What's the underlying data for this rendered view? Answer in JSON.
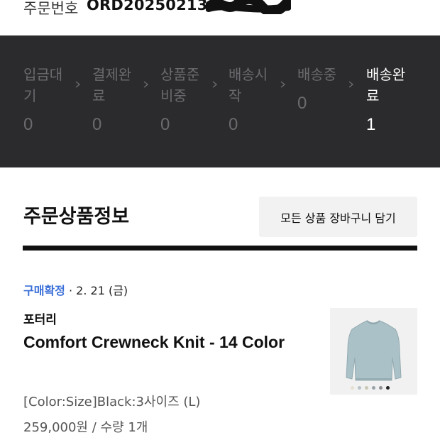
{
  "order": {
    "label": "주문번호",
    "number": "ORD20250213-"
  },
  "steps": [
    {
      "label": "입금대기",
      "count": "0"
    },
    {
      "label": "결제완료",
      "count": "0"
    },
    {
      "label": "상품준비중",
      "count": "0"
    },
    {
      "label": "배송시작",
      "count": "0"
    },
    {
      "label": "배송중",
      "count": "0"
    },
    {
      "label": "배송완료",
      "count": "1"
    }
  ],
  "section": {
    "title": "주문상품정보",
    "cart_all_label": "모든 상품 장바구니 담기"
  },
  "item": {
    "status": "구매확정",
    "date": "· 2. 21 (금)",
    "brand": "포터리",
    "name": "Comfort Crewneck Knit - 14 Color",
    "option": "[Color:Size]Black:3사이즈 (L)",
    "price_qty": "259,000원 / 수량 1개",
    "swatch_colors": [
      "#e6e0d2",
      "#b8c2c8",
      "#c9c8b6",
      "#9aa3a9",
      "#8f8f93",
      "#222222"
    ]
  },
  "colors": {
    "accent": "#3a6fd8",
    "panel": "#2b2b2d",
    "muted": "#6b6b6f"
  }
}
